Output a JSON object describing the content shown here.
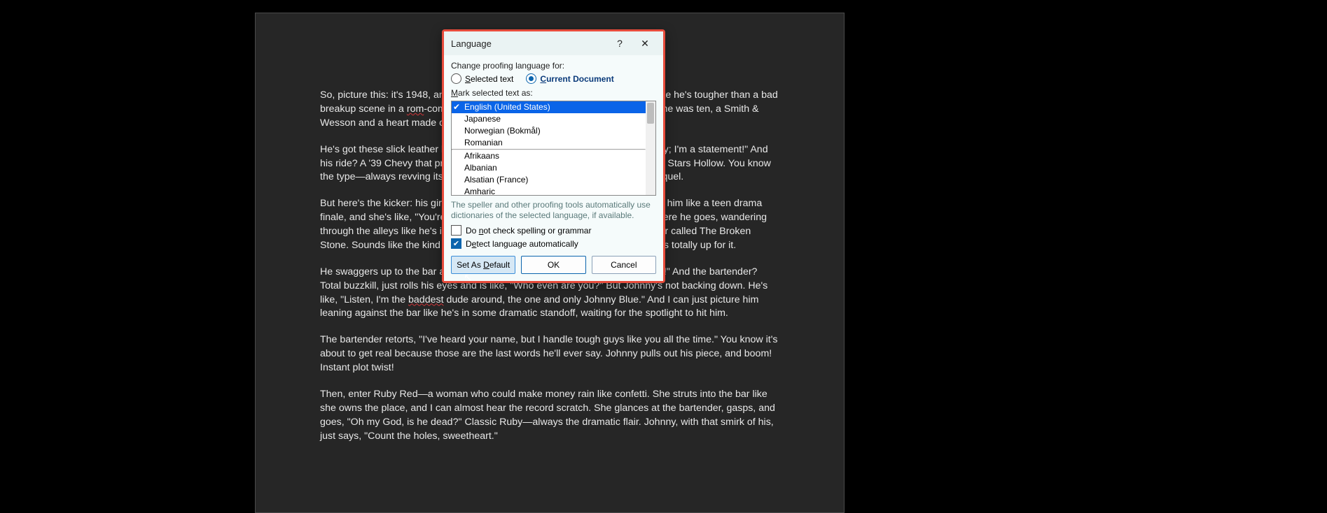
{
  "document": {
    "p1": "So, picture this: it's 1948, and there's this guy, Johnny Blue, strutting around like he's tougher than a bad breakup scene in a rom-com. Seriously—this dude's been packing heat since he was ten, a Smith & Wesson and a heart made of steel—like, \"Who needs feelings, right?\"",
    "p2": "He's got these slick leather boots that practically scream, \"I'm not just a cowboy; I'm a statement!\" And his ride? A '39 Chevy that probably has more horsepower than all the drama at Stars Hollow. You know the type—always revving its engine like it's auditioning for a Fast & Furious sequel.",
    "p3": "But here's the kicker: his girlfriend Sally just dumped him. I mean, she ghosted him like a teen drama finale, and she's like, \"You're too reckless, Johnny!\" Classic Sally move. So, there he goes, wandering through the alleys like he's in a sad music video, and he stumbles upon this bar called The Broken Stone. Sounds like the kind of place where bad decisions are made, right? He's totally up for it.",
    "p4": "He swaggers up to the bar and basically demands, \"Get me the strongest shot!\" And the bartender? Total buzzkill, just rolls his eyes and is like, \"Who even are you?\" But Johnny's not backing down. He's like, \"Listen, I'm the baddest dude around, the one and only Johnny Blue.\" And I can just picture him leaning against the bar like he's in some dramatic standoff, waiting for the spotlight to hit him.",
    "p5": "The bartender retorts, \"I've heard your name, but I handle tough guys like you all the time.\" You know it's about to get real because those are the last words he'll ever say. Johnny pulls out his piece, and boom! Instant plot twist!",
    "p6": "Then, enter Ruby Red—a woman who could make money rain like confetti. She struts into the bar like she owns the place, and I can almost hear the record scratch. She glances at the bartender, gasps, and goes, \"Oh my God, is he dead?\" Classic Ruby—always the dramatic flair. Johnny, with that smirk of his, just says, \"Count the holes, sweetheart.\"",
    "squiggle_words": {
      "rom": "rom",
      "baddest": "baddest"
    }
  },
  "dialog": {
    "title": "Language",
    "help_symbol": "?",
    "close_symbol": "✕",
    "change_label": "Change proofing language for:",
    "radio_selected_pre": "S",
    "radio_selected_rest": "elected text",
    "radio_current_pre": "C",
    "radio_current_rest": "urrent Document",
    "mark_label_pre": "M",
    "mark_label_rest": "ark selected text as:",
    "languages": {
      "selected": "English (United States)",
      "items_top": [
        "Japanese",
        "Norwegian (Bokmål)",
        "Romanian"
      ],
      "items_bottom": [
        "Afrikaans",
        "Albanian",
        "Alsatian (France)",
        "Amharic"
      ]
    },
    "hint": "The speller and other proofing tools automatically use dictionaries of the selected language, if available.",
    "chk1_pre": "Do ",
    "chk1_u": "n",
    "chk1_rest": "ot check spelling or grammar",
    "chk2_pre": "D",
    "chk2_u": "e",
    "chk2_rest": "tect language automatically",
    "btn_default_pre": "Set As ",
    "btn_default_u": "D",
    "btn_default_rest": "efault",
    "btn_ok": "OK",
    "btn_cancel": "Cancel"
  }
}
